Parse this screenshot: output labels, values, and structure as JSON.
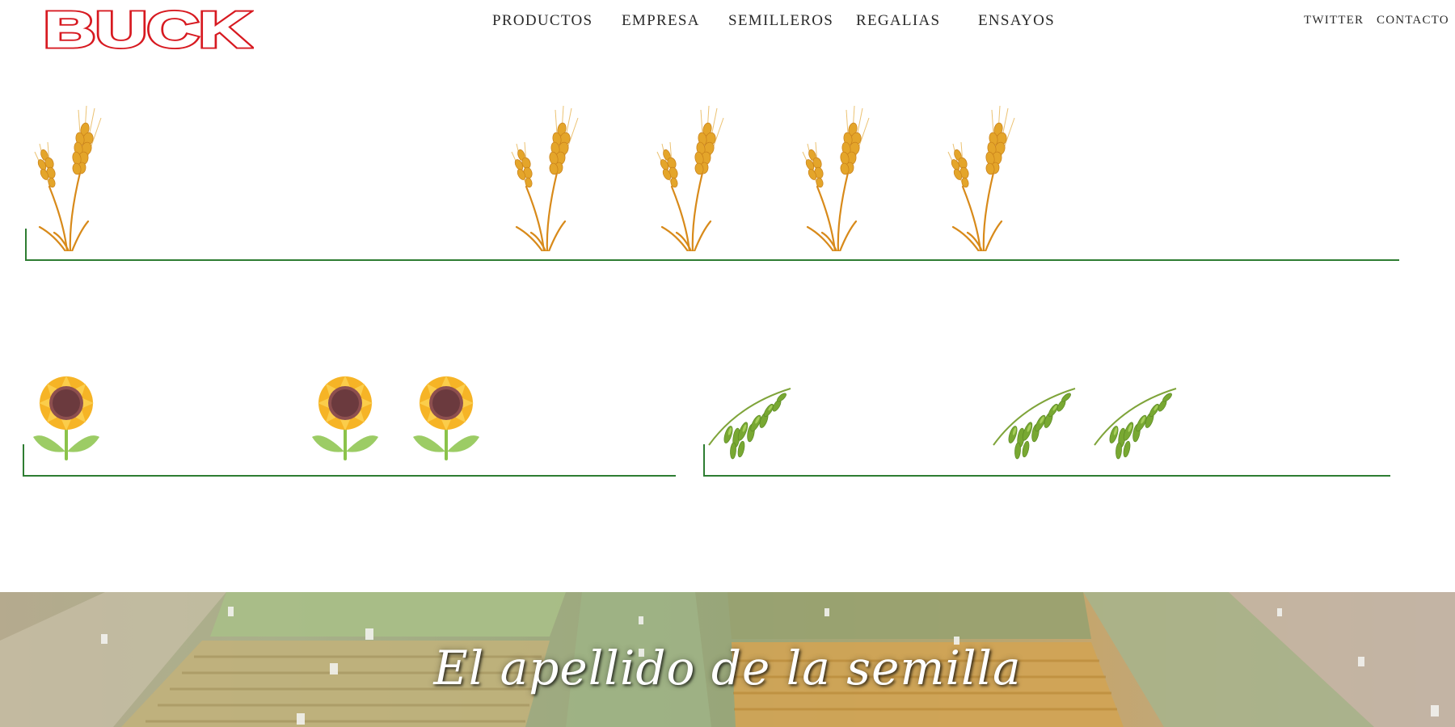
{
  "brand": {
    "logo_text": "BUCK",
    "color": "#d71920"
  },
  "nav": {
    "items": [
      {
        "label": "PRODUCTOS"
      },
      {
        "label": "EMPRESA"
      },
      {
        "label": "SEMILLEROS"
      },
      {
        "label": "REGALIAS"
      },
      {
        "label": "ENSAYOS"
      }
    ]
  },
  "social": {
    "twitter": "TWITTER",
    "contacto": "CONTACTO"
  },
  "crops": {
    "wheat": {
      "icon": "wheat-icon",
      "count": 5,
      "accent": "#e1a52a"
    },
    "sunflower": {
      "icon": "sunflower-icon",
      "count": 3,
      "accent": "#f8c13a"
    },
    "oat": {
      "icon": "oat-icon",
      "count": 3,
      "accent": "#6f9c2d"
    }
  },
  "colors": {
    "shelf_line": "#2e7d32"
  },
  "hero": {
    "tagline": "El apellido de la semilla"
  }
}
